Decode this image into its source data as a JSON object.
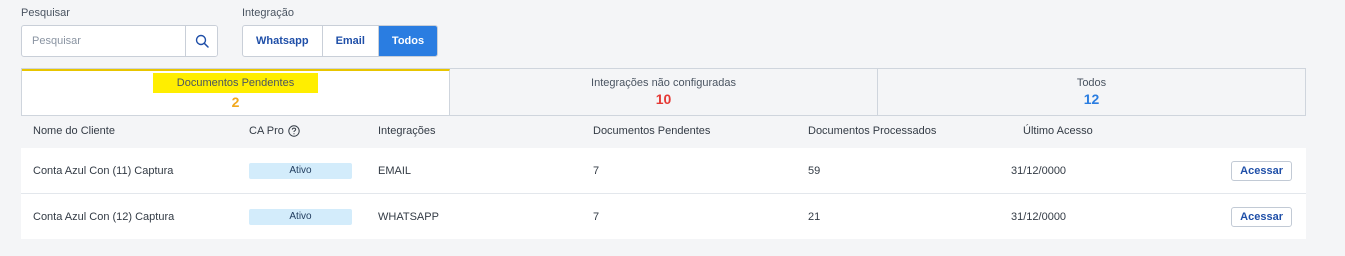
{
  "filters": {
    "search": {
      "label": "Pesquisar",
      "placeholder": "Pesquisar",
      "value": ""
    },
    "integration": {
      "label": "Integração",
      "options": [
        {
          "label": "Whatsapp",
          "active": false
        },
        {
          "label": "Email",
          "active": false
        },
        {
          "label": "Todos",
          "active": true
        }
      ]
    }
  },
  "tabs": [
    {
      "label": "Documentos Pendentes",
      "count": "2",
      "color": "#f2a81d",
      "active": true
    },
    {
      "label": "Integrações não configuradas",
      "count": "10",
      "color": "#e53935",
      "active": false
    },
    {
      "label": "Todos",
      "count": "12",
      "color": "#2a7de1",
      "active": false
    }
  ],
  "table": {
    "headers": {
      "client": "Nome do Cliente",
      "ca_pro": "CA Pro",
      "integrations": "Integrações",
      "pending": "Documentos Pendentes",
      "processed": "Documentos Processados",
      "last_access": "Último Acesso"
    },
    "rows": [
      {
        "client": "Conta Azul Con (11) Captura",
        "ca_pro": "Ativo",
        "integration": "EMAIL",
        "pending": "7",
        "processed": "59",
        "last_access": "31/12/0000",
        "action": "Acessar"
      },
      {
        "client": "Conta Azul Con (12) Captura",
        "ca_pro": "Ativo",
        "integration": "WHATSAPP",
        "pending": "7",
        "processed": "21",
        "last_access": "31/12/0000",
        "action": "Acessar"
      }
    ]
  }
}
